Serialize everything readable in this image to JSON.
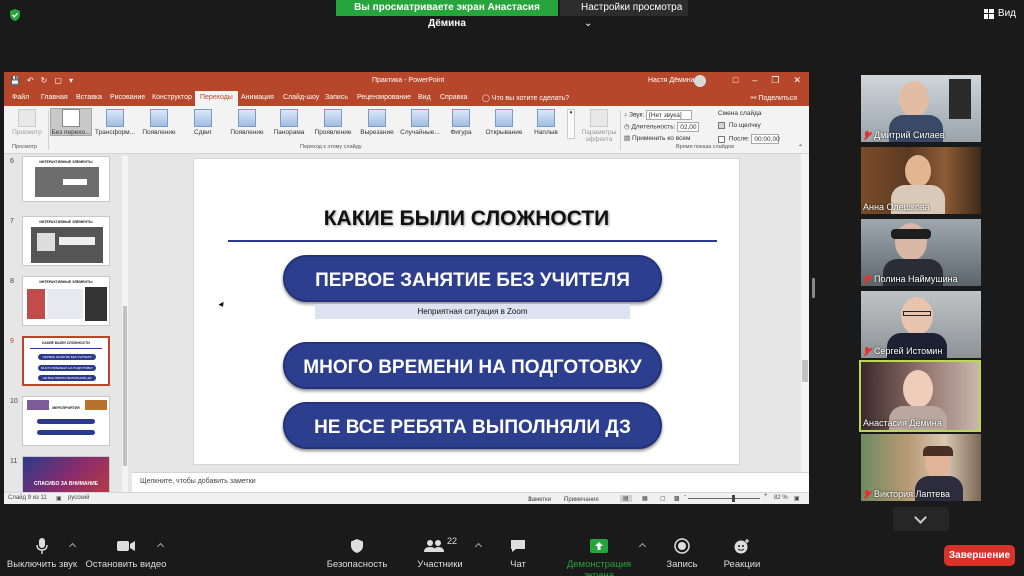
{
  "zoom": {
    "banner_text": "Вы просматриваете экран Анастасия Дёмина",
    "view_settings_label": "Настройки просмотра",
    "view_label": "Вид",
    "toolbar": {
      "mute": "Выключить звук",
      "video": "Остановить видео",
      "security": "Безопасность",
      "participants": "Участники",
      "participants_count": "22",
      "chat": "Чат",
      "share": "Демонстрация экрана",
      "record": "Запись",
      "reactions": "Реакции",
      "end": "Завершение"
    },
    "participants": [
      {
        "name": "Дмитрий Силаев",
        "muted": true
      },
      {
        "name": "Анна Олешкова",
        "muted": false
      },
      {
        "name": "Полина Наймушина",
        "muted": true
      },
      {
        "name": "Сергей Истомин",
        "muted": true
      },
      {
        "name": "Анастасия Дёмина",
        "muted": false
      },
      {
        "name": "Виктория Лаптева",
        "muted": true
      }
    ],
    "colors": {
      "green": "#25a53b",
      "end_red": "#d9322b",
      "speaker_border": "#b9d94e"
    }
  },
  "ppt": {
    "window_title": "Практика - PowerPoint",
    "user": "Настя Дёмина",
    "tabs": [
      "Файл",
      "Главная",
      "Вставка",
      "Рисование",
      "Конструктор",
      "Переходы",
      "Анимация",
      "Слайд-шоу",
      "Запись",
      "Рецензирование",
      "Вид",
      "Справка"
    ],
    "active_tab": "Переходы",
    "tell_me": "Что вы хотите сделать?",
    "share": "Поделиться",
    "ribbon": {
      "preview": "Просмотр",
      "transitions": [
        "Без перехо...",
        "Трансформ...",
        "Появление",
        "Сдвиг",
        "Появление",
        "Панорама",
        "Проявление",
        "Вырезание",
        "Случайные...",
        "Фигура",
        "Открывание",
        "Наплыв"
      ],
      "effect_params": "Параметры эффекта",
      "group_preview": "Просмотр",
      "group_transition": "Переход к этому слайду",
      "group_timing": "Время показа слайдов",
      "sound_label": "Звук:",
      "sound_value": "[Нет звука]",
      "duration_label": "Длительность:",
      "duration_value": "02,00",
      "apply_all": "Применить ко всем",
      "advance_label": "Смена слайда",
      "on_click": "По щелчку",
      "after_label": "После:",
      "after_value": "00:00,00"
    },
    "thumbs": [
      {
        "num": "6",
        "title": "ИНТЕРАКТИВНЫЕ ЭЛЕМЕНТЫ"
      },
      {
        "num": "7",
        "title": "ИНТЕРАКТИВНЫЕ ЭЛЕМЕНТЫ"
      },
      {
        "num": "8",
        "title": "ИНТЕРАКТИВНЫЕ ЭЛЕМЕНТЫ"
      },
      {
        "num": "9",
        "title": "КАКИЕ БЫЛИ СЛОЖНОСТИ",
        "pills": [
          "ПЕРВОЕ ЗАНЯТИЕ БЕЗ УЧИТЕЛЯ",
          "МНОГО ВРЕМЕНИ НА ПОДГОТОВКУ",
          "НЕ ВСЕ РЕБЯТА ВЫПОЛНЯЛИ ДЗ"
        ]
      },
      {
        "num": "10",
        "title": "МЕРОПРИЯТИЯ"
      },
      {
        "num": "11",
        "title": "СПАСИБО ЗА ВНИМАНИЕ"
      }
    ],
    "slide": {
      "title": "КАКИЕ БЫЛИ СЛОЖНОСТИ",
      "pill1": "ПЕРВОЕ ЗАНЯТИЕ БЕЗ УЧИТЕЛЯ",
      "note": "Неприятная ситуация в Zoom",
      "pill2": "МНОГО ВРЕМЕНИ НА ПОДГОТОВКУ",
      "pill3": "НЕ ВСЕ РЕБЯТА ВЫПОЛНЯЛИ ДЗ"
    },
    "notes_placeholder": "Щелкните, чтобы добавить заметки",
    "status": {
      "slide_info": "Слайд 9 из 11",
      "language": "русский",
      "notes": "Заметки",
      "comments": "Примечания",
      "zoom": "82 %"
    },
    "accent": "#b7472a",
    "slide_blue": "#2d3e8f"
  }
}
